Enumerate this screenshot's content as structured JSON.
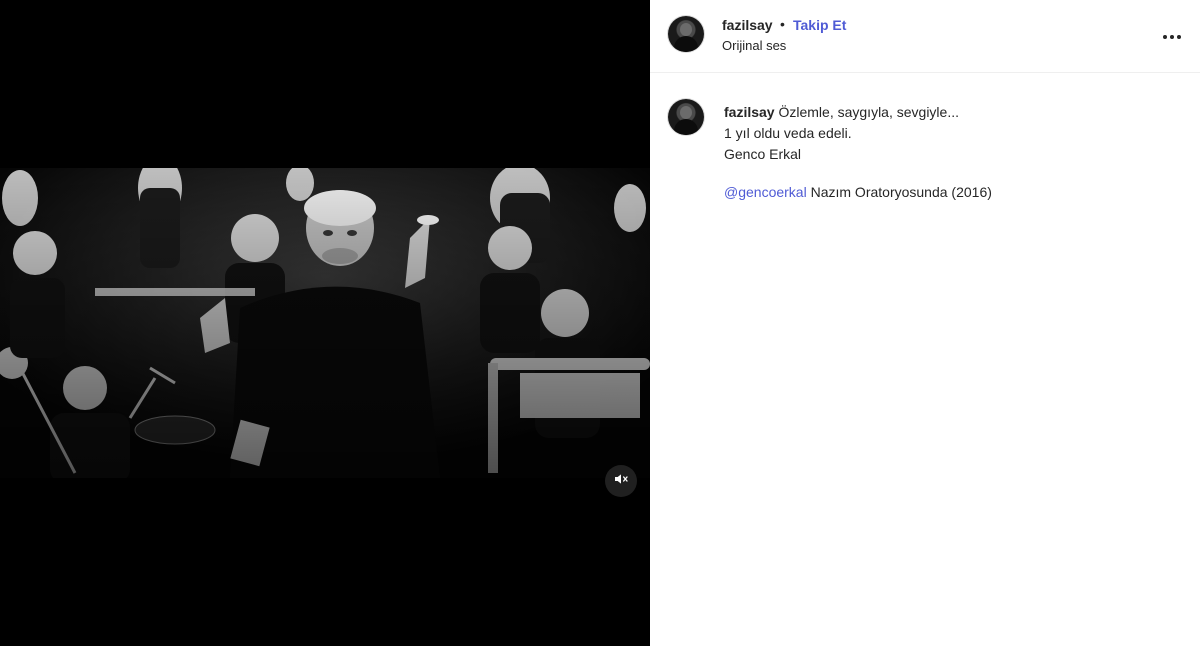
{
  "header": {
    "username": "fazilsay",
    "separator": "•",
    "follow_label": "Takip Et",
    "audio_label": "Orijinal ses",
    "more_icon": "more-horizontal-icon"
  },
  "media": {
    "mute_icon": "speaker-muted-icon"
  },
  "caption": {
    "username": "fazilsay",
    "line1": "Özlemle, saygıyla, sevgiyle...",
    "line2": "1 yıl oldu veda edeli.",
    "line3": "Genco Erkal",
    "mention": "@gencoerkal",
    "line4_rest": "Nazım Oratoryosunda (2016)"
  }
}
